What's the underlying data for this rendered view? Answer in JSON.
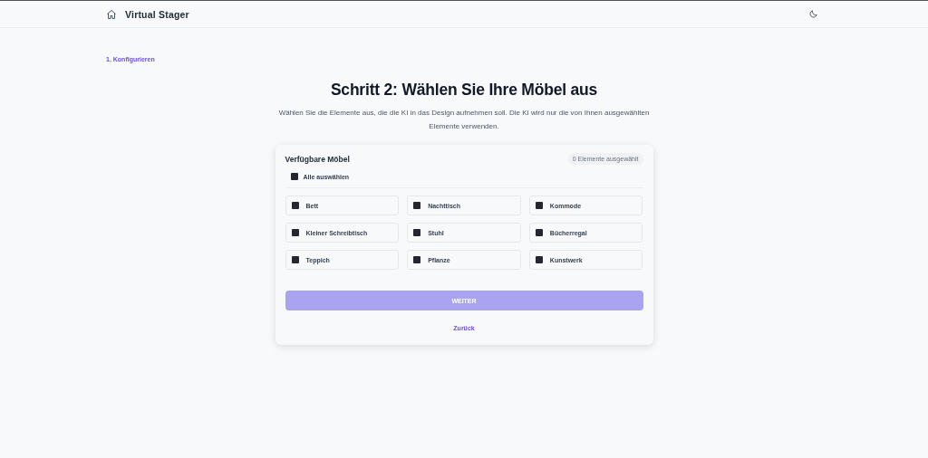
{
  "header": {
    "title": "Virtual Stager"
  },
  "breadcrumb": "1. Konfigurieren",
  "heading": "Schritt 2: Wählen Sie Ihre Möbel aus",
  "description": "Wählen Sie die Elemente aus, die die KI in das Design aufnehmen soll. Die KI wird nur die von Ihnen ausgewählten Elemente verwenden.",
  "card": {
    "title": "Verfügbare Möbel",
    "count_badge": "0 Elemente ausgewählt",
    "select_all": {
      "label": "Alle auswählen",
      "checked": false
    },
    "items": [
      {
        "label": "Bett",
        "checked": false
      },
      {
        "label": "Nachttisch",
        "checked": false
      },
      {
        "label": "Kommode",
        "checked": false
      },
      {
        "label": "Kleiner Schreibtisch",
        "checked": false
      },
      {
        "label": "Stuhl",
        "checked": false
      },
      {
        "label": "Bücherregal",
        "checked": false
      },
      {
        "label": "Teppich",
        "checked": false
      },
      {
        "label": "Pflanze",
        "checked": false
      },
      {
        "label": "Kunstwerk",
        "checked": false
      }
    ],
    "next_button": {
      "label": "WEITER",
      "disabled": true
    },
    "back_link": "Zurück"
  }
}
